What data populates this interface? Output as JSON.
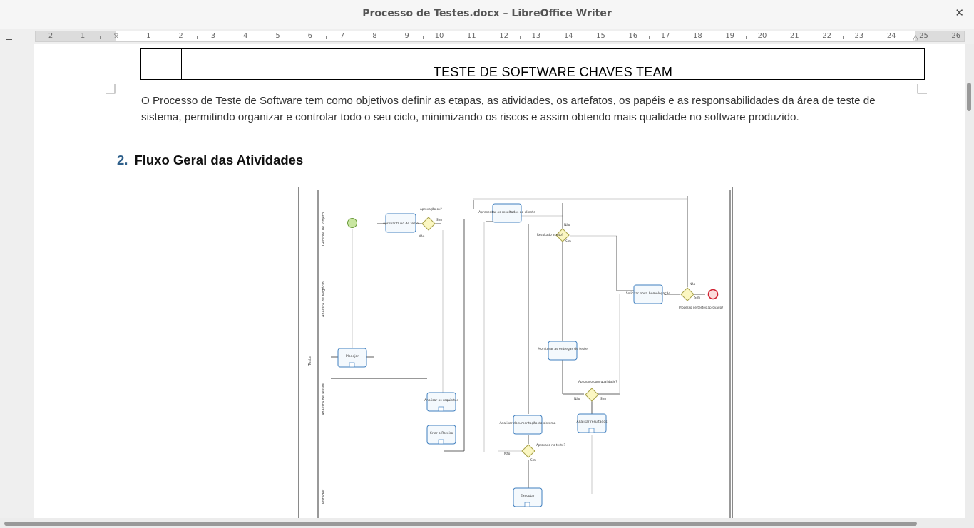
{
  "window": {
    "title": "Processo de Testes.docx – LibreOffice Writer"
  },
  "ruler": {
    "left_labels": [
      "2",
      "1"
    ],
    "labels": [
      "1",
      "2",
      "3",
      "4",
      "5",
      "6",
      "7",
      "8",
      "9",
      "10",
      "11",
      "12",
      "13",
      "14",
      "15",
      "16",
      "17",
      "18",
      "19",
      "20",
      "21",
      "22",
      "23",
      "24",
      "25",
      "26"
    ]
  },
  "document": {
    "header_table_title": "TESTE DE SOFTWARE CHAVES TEAM",
    "intro_paragraph": "O Processo de Teste de Software tem como objetivos definir as etapas, as atividades, os artefatos, os papéis e as responsabilidades da área de teste de sistema, permitindo organizar e controlar todo o seu ciclo, minimizando os riscos e assim obtendo mais qualidade no software produzido.",
    "section_number": "2.",
    "section_title": "Fluxo Geral das Atividades"
  },
  "diagram": {
    "lane_labels": [
      "Gerente de Projeto",
      "Analista de Negócio",
      "Teste",
      "Analista de Testes",
      "Testador"
    ],
    "tasks": [
      "Aprovar fluxo de teste",
      "Planejar",
      "Analisar os requisitos",
      "Criar o Roteiro",
      "Apresentar os resultados ao cliente",
      "Solicitar nova homologação",
      "Monitorar as entregas de teste",
      "Analisar documentação do sistema",
      "Analisar resultados",
      "Executar"
    ],
    "gateway_labels": [
      "Aprovação ok?",
      "Sim",
      "Não",
      "Resultado aceito?",
      "Sim",
      "Não",
      "Processo de testes aprovado?",
      "Não",
      "Sim",
      "Aprovado com qualidade?",
      "Não",
      "Sim",
      "Aprovado no teste?",
      "Sim",
      "Não"
    ]
  },
  "colors": {
    "start_event": "#c8e6a0",
    "end_event": "#e8394a",
    "task_border": "#3f7fbf",
    "gateway_fill": "#fbf7c2",
    "heading_number": "#2e5f8a"
  }
}
